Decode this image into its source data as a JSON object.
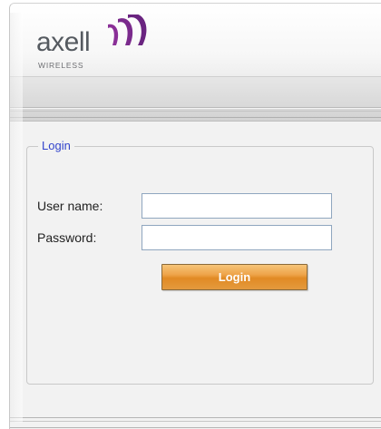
{
  "brand": {
    "name": "axell",
    "subtitle": "WIRELESS",
    "mark_color": "#7a2a8c"
  },
  "login": {
    "group_title": "Login",
    "username_label": "User name:",
    "username_value": "",
    "password_label": "Password:",
    "password_value": "",
    "submit_label": "Login"
  },
  "colors": {
    "legend_text": "#3344cc",
    "button_orange": "#e48a24"
  }
}
